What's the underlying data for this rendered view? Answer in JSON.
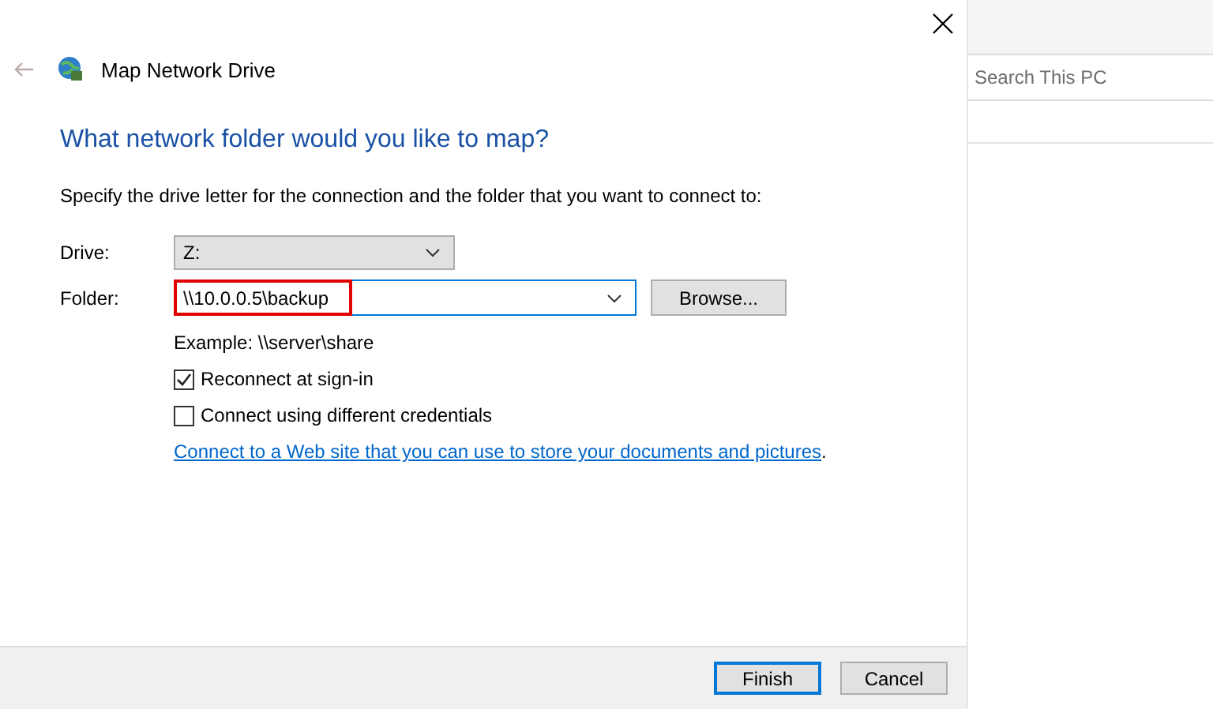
{
  "dialog": {
    "title": "Map Network Drive",
    "heading": "What network folder would you like to map?",
    "instruction": "Specify the drive letter for the connection and the folder that you want to connect to:",
    "drive": {
      "label": "Drive:",
      "value": "Z:"
    },
    "folder": {
      "label": "Folder:",
      "value": "\\\\10.0.0.5\\backup",
      "highlighted": true,
      "button": "Browse..."
    },
    "example": "Example: \\\\server\\share",
    "options": [
      {
        "label": "Reconnect at sign-in",
        "checked": true
      },
      {
        "label": "Connect using different credentials",
        "checked": false
      }
    ],
    "link": "Connect to a Web site that you can use to store your documents and pictures",
    "link_suffix": ".",
    "buttons": [
      {
        "label": "Finish",
        "default": true
      },
      {
        "label": "Cancel",
        "default": false
      }
    ]
  },
  "explorer": {
    "search": {
      "placeholder": "Search This PC"
    }
  }
}
